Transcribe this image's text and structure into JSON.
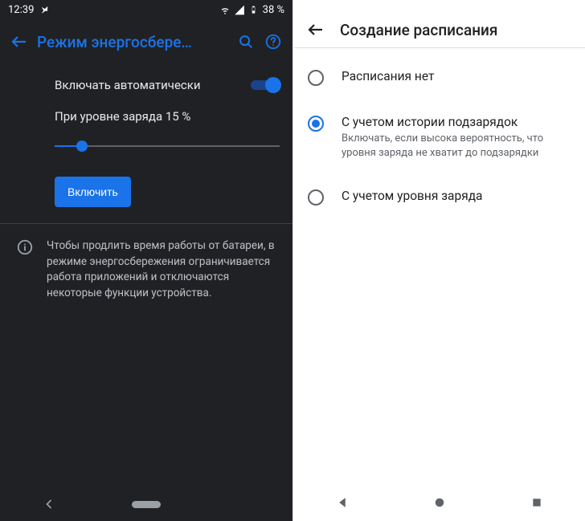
{
  "left": {
    "status": {
      "time": "12:39",
      "battery_text": "38 %"
    },
    "toolbar": {
      "title": "Режим энергосбере…"
    },
    "auto_toggle": {
      "label": "Включать автоматически",
      "value": true
    },
    "slider": {
      "label": "При уровне заряда 15 %",
      "percent": 15
    },
    "button": {
      "label": "Включить"
    },
    "info": "Чтобы продлить время работы от батареи, в режиме энергосбережения ограничивается работа приложений и отключаются некоторые функции устройства."
  },
  "right": {
    "toolbar": {
      "title": "Создание расписания"
    },
    "options": [
      {
        "title": "Расписания нет",
        "sub": "",
        "selected": false
      },
      {
        "title": "С учетом истории подзарядок",
        "sub": "Включать, если высока вероятность, что уровня заряда не хватит до подзарядки",
        "selected": true
      },
      {
        "title": "С учетом уровня заряда",
        "sub": "",
        "selected": false
      }
    ]
  }
}
